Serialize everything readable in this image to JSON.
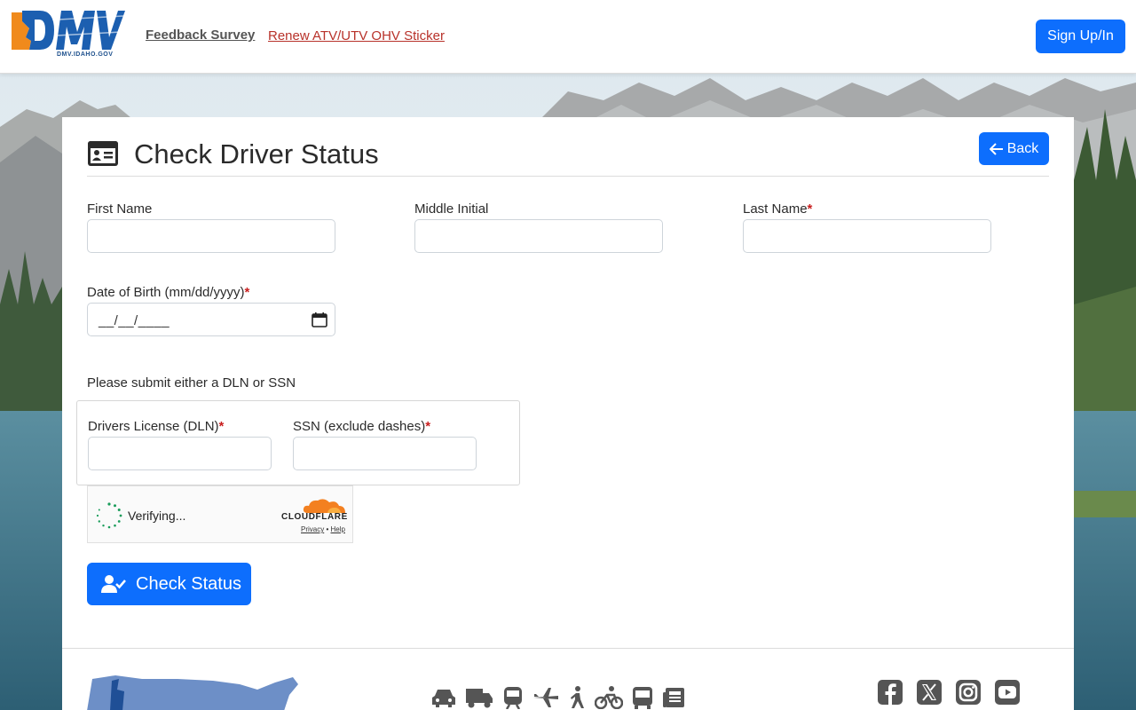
{
  "header": {
    "logo_text": "DMV",
    "logo_subtext": "DMV.IDAHO.GOV",
    "nav_links": [
      "Feedback Survey",
      "Renew ATV/UTV OHV Sticker"
    ],
    "signin_label": "Sign Up/In"
  },
  "page": {
    "title": "Check Driver Status",
    "back_label": "Back"
  },
  "form": {
    "first_name_label": "First Name",
    "middle_initial_label": "Middle Initial",
    "last_name_label": "Last Name",
    "dob_label": "Date of Birth (mm/dd/yyyy)",
    "dob_value": "__/__/____",
    "required_marker": "*",
    "id_instruction": "Please submit either a DLN or SSN",
    "dln_label": "Drivers License (DLN)",
    "ssn_label": "SSN (exclude dashes)",
    "submit_label": "Check Status"
  },
  "captcha": {
    "status": "Verifying...",
    "brand": "CLOUDFLARE",
    "privacy": "Privacy",
    "separator": "•",
    "help": "Help"
  },
  "footer": {
    "transport_icons": [
      "car-icon",
      "truck-icon",
      "train-icon",
      "airplane-icon",
      "pedestrian-icon",
      "bicycle-icon",
      "bus-icon",
      "newspaper-icon"
    ],
    "social_icons": [
      "facebook-icon",
      "x-icon",
      "instagram-icon",
      "youtube-icon"
    ]
  },
  "colors": {
    "primary": "#0d6efd",
    "required": "#c81e1e",
    "link_red": "#b8322a",
    "logo_orange": "#f08a1c",
    "logo_blue": "#1c5fb0"
  }
}
